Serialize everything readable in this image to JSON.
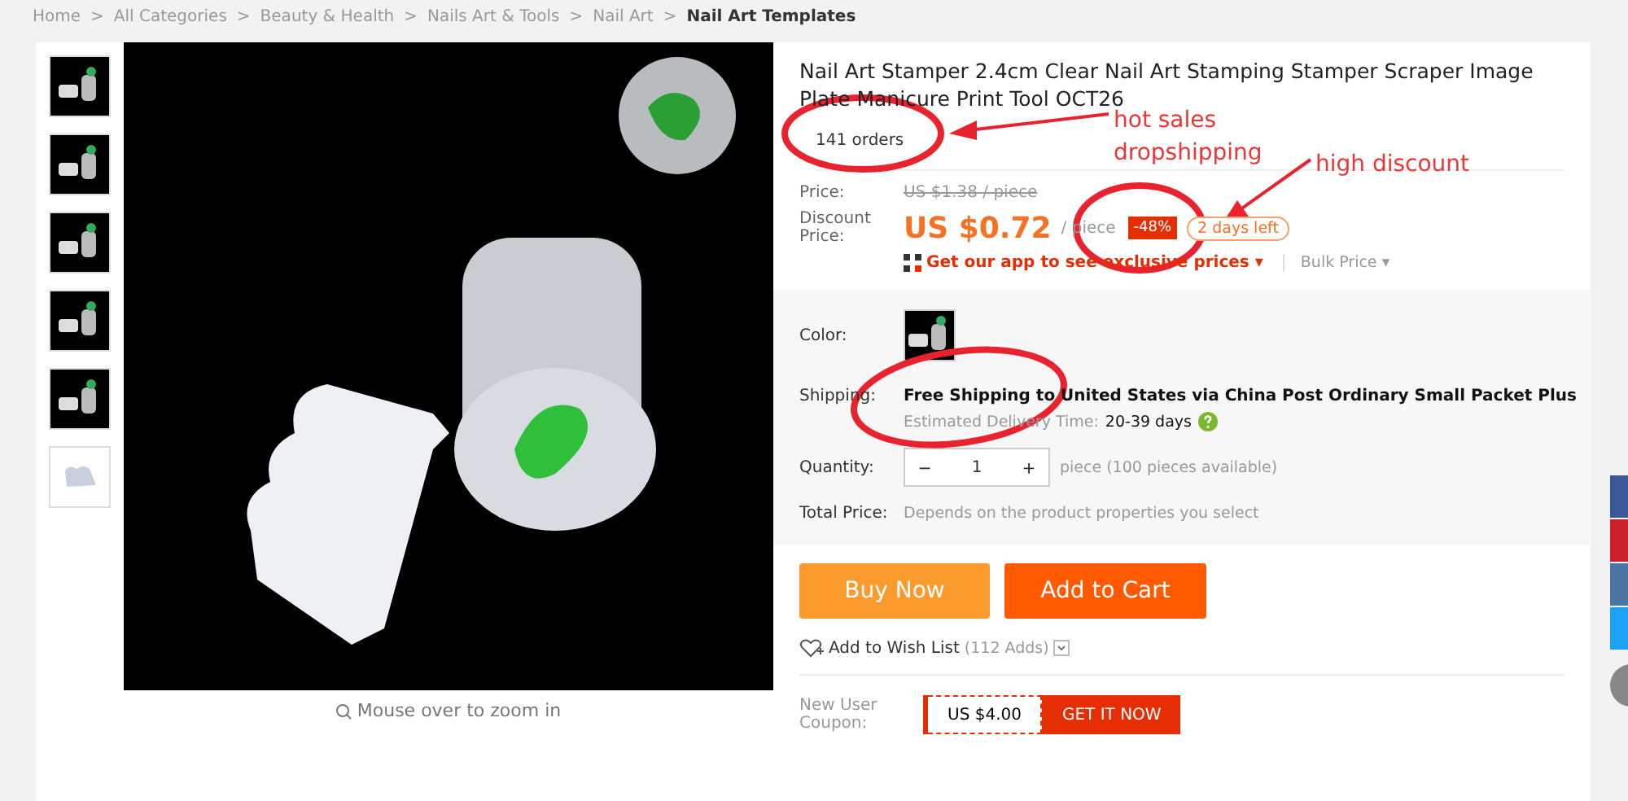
{
  "breadcrumb": {
    "separator": ">",
    "items": [
      {
        "label": "Home",
        "current": false
      },
      {
        "label": "All Categories",
        "current": false
      },
      {
        "label": "Beauty & Health",
        "current": false
      },
      {
        "label": "Nails Art & Tools",
        "current": false
      },
      {
        "label": "Nail Art",
        "current": false
      },
      {
        "label": "Nail Art Templates",
        "current": true
      }
    ]
  },
  "gallery": {
    "thumbnails": [
      {
        "kind": "dark"
      },
      {
        "kind": "dark"
      },
      {
        "kind": "dark"
      },
      {
        "kind": "dark"
      },
      {
        "kind": "dark"
      },
      {
        "kind": "light"
      }
    ],
    "zoom_hint": "Mouse over to zoom in"
  },
  "product": {
    "title": "Nail Art Stamper 2.4cm Clear Nail Art Stamping Stamper Scraper Image Plate Manicure Print Tool OCT26",
    "orders": "141 orders",
    "price_label": "Price:",
    "original_price": "US $1.38 / piece",
    "discount_label": "Discount Price:",
    "price": "US $0.72",
    "unit": "/ piece",
    "discount_badge": "-48%",
    "time_left": "2 days left",
    "app_promo": "Get our app to see exclusive prices",
    "app_promo_caret": "▾",
    "bulk_price": "Bulk Price",
    "bulk_price_caret": "▾"
  },
  "options": {
    "color_label": "Color:",
    "shipping_label": "Shipping:",
    "shipping_method": "Free Shipping to United States via China Post Ordinary Small Packet Plus",
    "delivery_label": "Estimated Delivery Time:",
    "delivery_value": "20-39 days",
    "quantity_label": "Quantity:",
    "decrement": "−",
    "quantity": "1",
    "increment": "+",
    "availability": "piece (100 pieces available)",
    "total_label": "Total Price:",
    "total_value": "Depends on the product properties you select"
  },
  "actions": {
    "buy_now": "Buy Now",
    "add_to_cart": "Add to Cart",
    "wish_list": "Add to Wish List",
    "wish_count": "(112 Adds)"
  },
  "coupon": {
    "label": "New User Coupon:",
    "amount": "US $4.00",
    "button": "GET IT NOW"
  },
  "share_bar": [
    {
      "kind": "facebook"
    },
    {
      "kind": "pinterest"
    },
    {
      "kind": "vk"
    },
    {
      "kind": "twitter"
    },
    {
      "kind": "more"
    }
  ],
  "annotations": [
    {
      "lines": [
        "hot sales",
        "dropshipping"
      ]
    },
    {
      "lines": [
        "high discount"
      ]
    }
  ]
}
